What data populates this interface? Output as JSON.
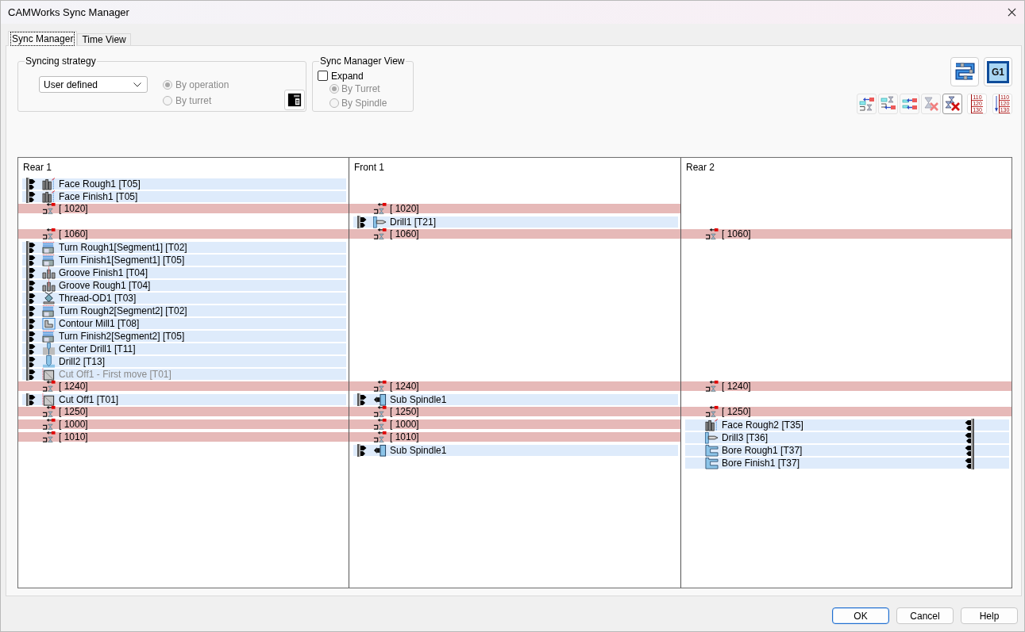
{
  "window": {
    "title": "CAMWorks Sync Manager"
  },
  "tabs": [
    {
      "label": "Sync Manager",
      "selected": true
    },
    {
      "label": "Time View",
      "selected": false
    }
  ],
  "syncing_strategy": {
    "title": "Syncing strategy",
    "dropdown": {
      "value": "User defined"
    },
    "options": [
      {
        "label": "By operation",
        "selected": true,
        "disabled": true
      },
      {
        "label": "By turret",
        "selected": false,
        "disabled": true
      }
    ]
  },
  "sync_manager_view": {
    "title": "Sync Manager View",
    "expand": {
      "label": "Expand",
      "checked": false
    },
    "options": [
      {
        "label": "By Turret",
        "selected": true,
        "disabled": true
      },
      {
        "label": "By Spindle",
        "selected": false,
        "disabled": true
      }
    ]
  },
  "toolbar": {
    "large": [
      {
        "kind": "path"
      },
      {
        "kind": "code",
        "label": "G1"
      }
    ],
    "small": [
      {
        "kind": "addbelow",
        "pressed": false
      },
      {
        "kind": "addabove",
        "pressed": false
      },
      {
        "kind": "addpair",
        "pressed": false
      },
      {
        "kind": "remove",
        "pressed": false
      },
      {
        "kind": "removeall",
        "pressed": true
      },
      {
        "kind": "numbers",
        "pressed": false,
        "lines": [
          "110",
          "120",
          "130"
        ]
      },
      {
        "kind": "renumber",
        "pressed": false,
        "lines": [
          "110",
          "120",
          "130"
        ]
      }
    ]
  },
  "sync_view": {
    "columns": [
      {
        "title": "Rear 1",
        "mirrored": false,
        "rows": [
          {
            "kind": "face",
            "label": "Face Rough1 [T05]",
            "disabled": false
          },
          {
            "kind": "face",
            "label": "Face Finish1 [T05]",
            "disabled": false
          },
          {
            "kind": "sync",
            "label": "[ 1020]"
          },
          {
            "kind": "gap"
          },
          {
            "kind": "sync",
            "label": "[ 1060]"
          },
          {
            "kind": "turn",
            "label": "Turn Rough1[Segment1] [T02]",
            "disabled": false
          },
          {
            "kind": "turn",
            "label": "Turn Finish1[Segment1] [T05]",
            "disabled": false
          },
          {
            "kind": "groove",
            "label": "Groove Finish1 [T04]",
            "disabled": false
          },
          {
            "kind": "groove",
            "label": "Groove Rough1 [T04]",
            "disabled": false
          },
          {
            "kind": "thread",
            "label": "Thread-OD1 [T03]",
            "disabled": false
          },
          {
            "kind": "turn",
            "label": "Turn Rough2[Segment2] [T02]",
            "disabled": false
          },
          {
            "kind": "contour",
            "label": "Contour Mill1 [T08]",
            "disabled": false
          },
          {
            "kind": "turn",
            "label": "Turn Finish2[Segment2] [T05]",
            "disabled": false
          },
          {
            "kind": "centerdrill",
            "label": "Center Drill1 [T11]",
            "disabled": false
          },
          {
            "kind": "drill",
            "label": "Drill2 [T13]",
            "disabled": false
          },
          {
            "kind": "cutoff",
            "label": "Cut Off1 - First move [T01]",
            "disabled": true
          },
          {
            "kind": "sync",
            "label": "[ 1240]"
          },
          {
            "kind": "cutoff",
            "label": "Cut Off1 [T01]",
            "disabled": false
          },
          {
            "kind": "sync",
            "label": "[ 1250]"
          },
          {
            "kind": "sync",
            "label": "[ 1000]"
          },
          {
            "kind": "sync",
            "label": "[ 1010]"
          }
        ]
      },
      {
        "title": "Front 1",
        "mirrored": false,
        "rows": [
          {
            "kind": "gap"
          },
          {
            "kind": "gap"
          },
          {
            "kind": "sync",
            "label": "[ 1020]"
          },
          {
            "kind": "axialdrill",
            "label": "Drill1 [T21]",
            "disabled": false
          },
          {
            "kind": "sync",
            "label": "[ 1060]"
          },
          {
            "kind": "gap"
          },
          {
            "kind": "gap"
          },
          {
            "kind": "gap"
          },
          {
            "kind": "gap"
          },
          {
            "kind": "gap"
          },
          {
            "kind": "gap"
          },
          {
            "kind": "gap"
          },
          {
            "kind": "gap"
          },
          {
            "kind": "gap"
          },
          {
            "kind": "gap"
          },
          {
            "kind": "gap"
          },
          {
            "kind": "sync",
            "label": "[ 1240]"
          },
          {
            "kind": "spindle",
            "label": "Sub Spindle1",
            "disabled": false
          },
          {
            "kind": "sync",
            "label": "[ 1250]"
          },
          {
            "kind": "sync",
            "label": "[ 1000]"
          },
          {
            "kind": "sync",
            "label": "[ 1010]"
          },
          {
            "kind": "spindle",
            "label": "Sub Spindle1",
            "disabled": false
          }
        ]
      },
      {
        "title": "Rear 2",
        "mirrored": true,
        "rows": [
          {
            "kind": "gap"
          },
          {
            "kind": "gap"
          },
          {
            "kind": "gap"
          },
          {
            "kind": "gap"
          },
          {
            "kind": "sync",
            "label": "[ 1060]"
          },
          {
            "kind": "gap"
          },
          {
            "kind": "gap"
          },
          {
            "kind": "gap"
          },
          {
            "kind": "gap"
          },
          {
            "kind": "gap"
          },
          {
            "kind": "gap"
          },
          {
            "kind": "gap"
          },
          {
            "kind": "gap"
          },
          {
            "kind": "gap"
          },
          {
            "kind": "gap"
          },
          {
            "kind": "gap"
          },
          {
            "kind": "sync",
            "label": "[ 1240]"
          },
          {
            "kind": "gap"
          },
          {
            "kind": "sync",
            "label": "[ 1250]"
          },
          {
            "kind": "face",
            "label": "Face Rough2 [T35]",
            "disabled": false
          },
          {
            "kind": "axialdrill",
            "label": "Drill3 [T36]",
            "disabled": false
          },
          {
            "kind": "bore",
            "label": "Bore Rough1 [T37]",
            "disabled": false
          },
          {
            "kind": "bore",
            "label": "Bore Finish1 [T37]",
            "disabled": false
          }
        ]
      }
    ]
  },
  "buttons": [
    {
      "label": "OK",
      "default": true
    },
    {
      "label": "Cancel",
      "default": false
    },
    {
      "label": "Help",
      "default": false
    }
  ]
}
